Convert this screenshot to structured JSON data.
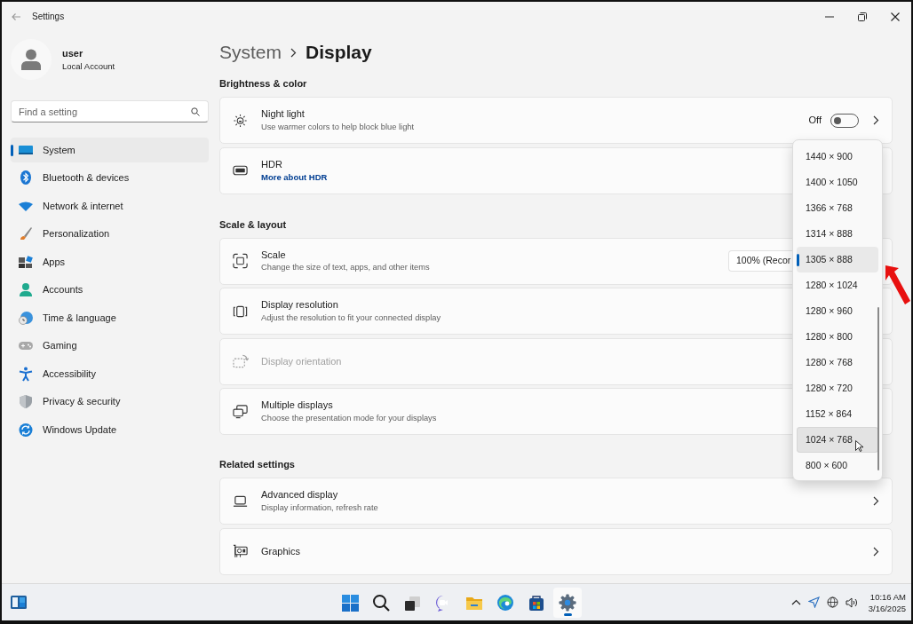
{
  "window": {
    "title": "Settings"
  },
  "account": {
    "name": "user",
    "type": "Local Account"
  },
  "search": {
    "placeholder": "Find a setting"
  },
  "nav": [
    {
      "label": "System",
      "selected": true
    },
    {
      "label": "Bluetooth & devices",
      "selected": false
    },
    {
      "label": "Network & internet",
      "selected": false
    },
    {
      "label": "Personalization",
      "selected": false
    },
    {
      "label": "Apps",
      "selected": false
    },
    {
      "label": "Accounts",
      "selected": false
    },
    {
      "label": "Time & language",
      "selected": false
    },
    {
      "label": "Gaming",
      "selected": false
    },
    {
      "label": "Accessibility",
      "selected": false
    },
    {
      "label": "Privacy & security",
      "selected": false
    },
    {
      "label": "Windows Update",
      "selected": false
    }
  ],
  "breadcrumb": {
    "parent": "System",
    "current": "Display"
  },
  "sections": [
    {
      "title": "Brightness & color",
      "rows": [
        {
          "kind": "toggle",
          "title": "Night light",
          "subtitle": "Use warmer colors to help block blue light",
          "state_label": "Off",
          "on": false,
          "disabled": false
        },
        {
          "kind": "link",
          "title": "HDR",
          "link": "More about HDR",
          "disabled": false
        }
      ]
    },
    {
      "title": "Scale & layout",
      "rows": [
        {
          "kind": "combo",
          "title": "Scale",
          "subtitle": "Change the size of text, apps, and other items",
          "value": "100% (Recor",
          "disabled": false
        },
        {
          "kind": "plain",
          "title": "Display resolution",
          "subtitle": "Adjust the resolution to fit your connected display",
          "disabled": false
        },
        {
          "kind": "plain",
          "title": "Display orientation",
          "disabled": true
        },
        {
          "kind": "plain",
          "title": "Multiple displays",
          "subtitle": "Choose the presentation mode for your displays",
          "disabled": false
        }
      ]
    },
    {
      "title": "Related settings",
      "rows": [
        {
          "kind": "nav",
          "title": "Advanced display",
          "subtitle": "Display information, refresh rate",
          "disabled": false
        },
        {
          "kind": "nav",
          "title": "Graphics",
          "disabled": false
        }
      ]
    }
  ],
  "resolution_menu": [
    {
      "label": "1440 × 900",
      "selected": false,
      "hovered": false
    },
    {
      "label": "1400 × 1050",
      "selected": false,
      "hovered": false
    },
    {
      "label": "1366 × 768",
      "selected": false,
      "hovered": false
    },
    {
      "label": "1314 × 888",
      "selected": false,
      "hovered": false
    },
    {
      "label": "1305 × 888",
      "selected": true,
      "hovered": false
    },
    {
      "label": "1280 × 1024",
      "selected": false,
      "hovered": false
    },
    {
      "label": "1280 × 960",
      "selected": false,
      "hovered": false
    },
    {
      "label": "1280 × 800",
      "selected": false,
      "hovered": false
    },
    {
      "label": "1280 × 768",
      "selected": false,
      "hovered": false
    },
    {
      "label": "1280 × 720",
      "selected": false,
      "hovered": false
    },
    {
      "label": "1152 × 864",
      "selected": false,
      "hovered": false
    },
    {
      "label": "1024 × 768",
      "selected": false,
      "hovered": true
    },
    {
      "label": "800 × 600",
      "selected": false,
      "hovered": false
    }
  ],
  "clock": {
    "time": "10:16 AM",
    "date": "3/16/2025"
  }
}
